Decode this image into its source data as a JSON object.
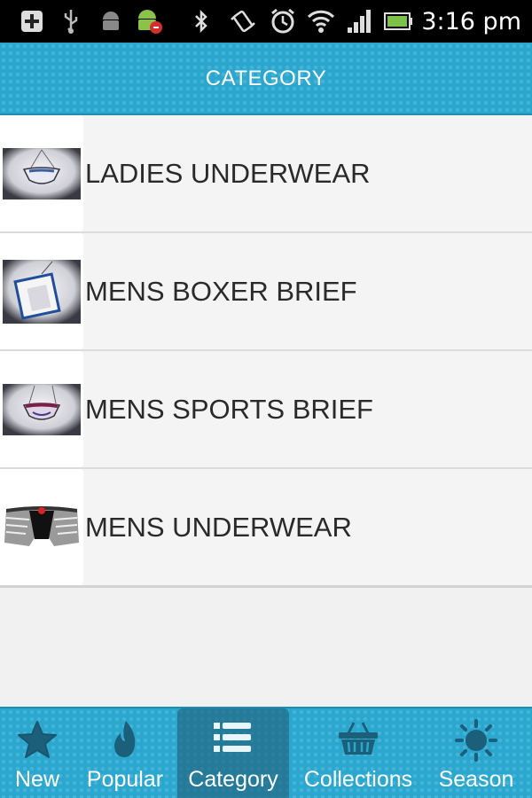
{
  "status_bar": {
    "time": "3:16 pm",
    "icons": [
      "plus-notification-icon",
      "usb-icon",
      "android-icon",
      "android-debug-icon",
      "bluetooth-icon",
      "vibrate-icon",
      "alarm-icon",
      "wifi-icon",
      "signal-icon",
      "battery-icon"
    ]
  },
  "header": {
    "title": "CATEGORY"
  },
  "categories": [
    {
      "label": "LADIES UNDERWEAR",
      "thumb": "ladies-underwear-thumbnail"
    },
    {
      "label": "MENS BOXER BRIEF",
      "thumb": "mens-boxer-brief-thumbnail"
    },
    {
      "label": "MENS SPORTS BRIEF",
      "thumb": "mens-sports-brief-thumbnail"
    },
    {
      "label": "MENS UNDERWEAR",
      "thumb": "mens-underwear-thumbnail"
    }
  ],
  "bottom_nav": [
    {
      "label": "New",
      "icon": "star-icon",
      "active": false
    },
    {
      "label": "Popular",
      "icon": "flame-icon",
      "active": false
    },
    {
      "label": "Category",
      "icon": "list-icon",
      "active": true
    },
    {
      "label": "Collections",
      "icon": "basket-icon",
      "active": false
    },
    {
      "label": "Season",
      "icon": "sun-icon",
      "active": false
    }
  ],
  "colors": {
    "accent": "#2aa7cf",
    "active_tab": "#1f5a73",
    "list_bg": "#f4f4f4"
  }
}
